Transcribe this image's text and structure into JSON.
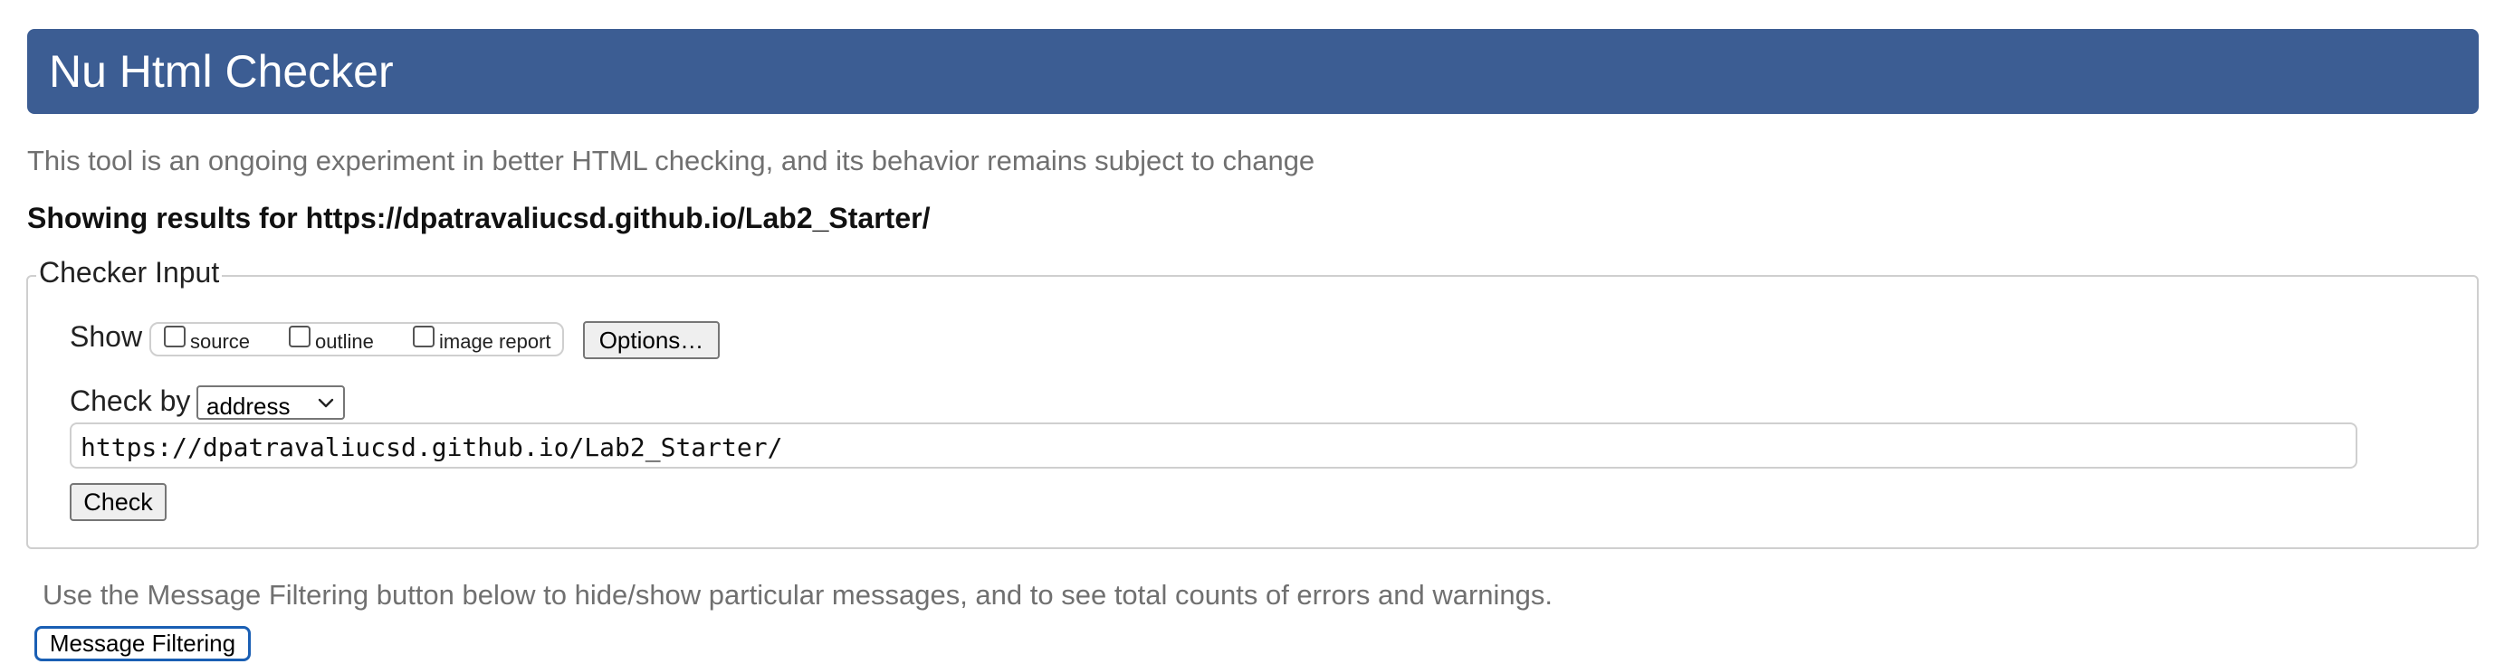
{
  "header": {
    "title": "Nu Html Checker"
  },
  "intro_text": "This tool is an ongoing experiment in better HTML checking, and its behavior remains subject to change",
  "results_line": "Showing results for https://dpatravaliucsd.github.io/Lab2_Starter/",
  "checker_input": {
    "legend": "Checker Input",
    "show_label": "Show",
    "show_options": [
      {
        "label": "source",
        "checked": false
      },
      {
        "label": "outline",
        "checked": false
      },
      {
        "label": "image report",
        "checked": false
      }
    ],
    "options_button": "Options…",
    "check_by_label": "Check by",
    "check_by_selected": "address",
    "url_value": "https://dpatravaliucsd.github.io/Lab2_Starter/",
    "check_button": "Check"
  },
  "filter_note": "Use the Message Filtering button below to hide/show particular messages, and to see total counts of errors and warnings.",
  "message_filtering_button": "Message Filtering",
  "colors": {
    "header_bg": "#3c5d93",
    "focus_ring": "#1a5fb4"
  }
}
